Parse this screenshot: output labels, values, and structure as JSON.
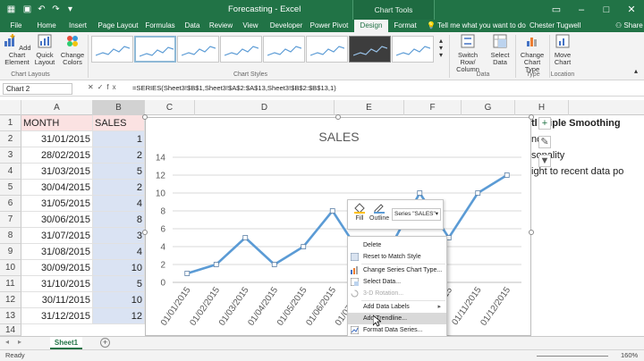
{
  "window": {
    "title": "Forecasting - Excel",
    "context_tab_group": "Chart Tools",
    "user": "Chester Tugwell",
    "tell_me": "Tell me what you want to do",
    "share": "Share"
  },
  "tabs": [
    "File",
    "Home",
    "Insert",
    "Page Layout",
    "Formulas",
    "Data",
    "Review",
    "View",
    "Developer",
    "Power Pivot",
    "Design",
    "Format"
  ],
  "active_tab": "Design",
  "ribbon": {
    "add_chart_element": "Add Chart Element",
    "quick_layout": "Quick Layout",
    "change_colors": "Change Colors",
    "switch_row_column": "Switch Row/ Column",
    "select_data": "Select Data",
    "change_chart_type": "Change Chart Type",
    "move_chart": "Move Chart",
    "groups": {
      "chart_layouts": "Chart Layouts",
      "chart_styles": "Chart Styles",
      "data": "Data",
      "type": "Type",
      "location": "Location"
    }
  },
  "name_box": "Chart 2",
  "formula": "=SERIES(Sheet3!$B$1,Sheet3!$A$2:$A$13,Sheet3!$B$2:$B$13,1)",
  "columns": [
    "A",
    "B",
    "C",
    "D",
    "E",
    "F",
    "G",
    "H"
  ],
  "rows": [
    "1",
    "2",
    "3",
    "4",
    "5",
    "6",
    "7",
    "8",
    "9",
    "10",
    "11",
    "12",
    "13",
    "14"
  ],
  "table": {
    "headers": [
      "MONTH",
      "SALES"
    ],
    "months": [
      "31/01/2015",
      "28/02/2015",
      "31/03/2015",
      "30/04/2015",
      "31/05/2015",
      "30/06/2015",
      "31/07/2015",
      "31/08/2015",
      "30/09/2015",
      "31/10/2015",
      "30/11/2015",
      "31/12/2015"
    ],
    "sales": [
      "1",
      "2",
      "5",
      "2",
      "4",
      "8",
      "3",
      "4",
      "10",
      "5",
      "10",
      "12"
    ]
  },
  "side_text": {
    "h1": "tl Triple Smoothing",
    "h2": "nc",
    "h3": "sonality",
    "h4": "ight to recent data po"
  },
  "chart_data": {
    "type": "line",
    "title": "SALES",
    "categories": [
      "01/01/2015",
      "01/02/2015",
      "01/03/2015",
      "01/04/2015",
      "01/05/2015",
      "01/06/2015",
      "01/07/2015",
      "01/08/2015",
      "01/09/2015",
      "01/10/2015",
      "01/11/2015",
      "01/12/2015"
    ],
    "series": [
      {
        "values": [
          1,
          2,
          5,
          2,
          4,
          8,
          3,
          4,
          10,
          5,
          10,
          12
        ]
      }
    ],
    "yticks": [
      "0",
      "2",
      "4",
      "6",
      "8",
      "10",
      "12",
      "14"
    ],
    "ylim": [
      0,
      14
    ],
    "grid": true,
    "line_color": "#5b9bd5"
  },
  "mini_toolbar": {
    "fill": "Fill",
    "outline": "Outline",
    "series_select": "Series \"SALES\""
  },
  "context_menu": {
    "delete": "Delete",
    "reset": "Reset to Match Style",
    "change_type": "Change Series Chart Type...",
    "select_data": "Select Data...",
    "rotation": "3-D Rotation...",
    "add_labels": "Add Data Labels",
    "add_trendline": "Add Trendline...",
    "format_series": "Format Data Series..."
  },
  "sheet_tab": "Sheet1",
  "status": {
    "ready": "Ready",
    "zoom": "160%"
  },
  "colors": {
    "excel_green": "#217346",
    "header_fill": "#fbe2e2",
    "sales_fill": "#dae3f3"
  }
}
